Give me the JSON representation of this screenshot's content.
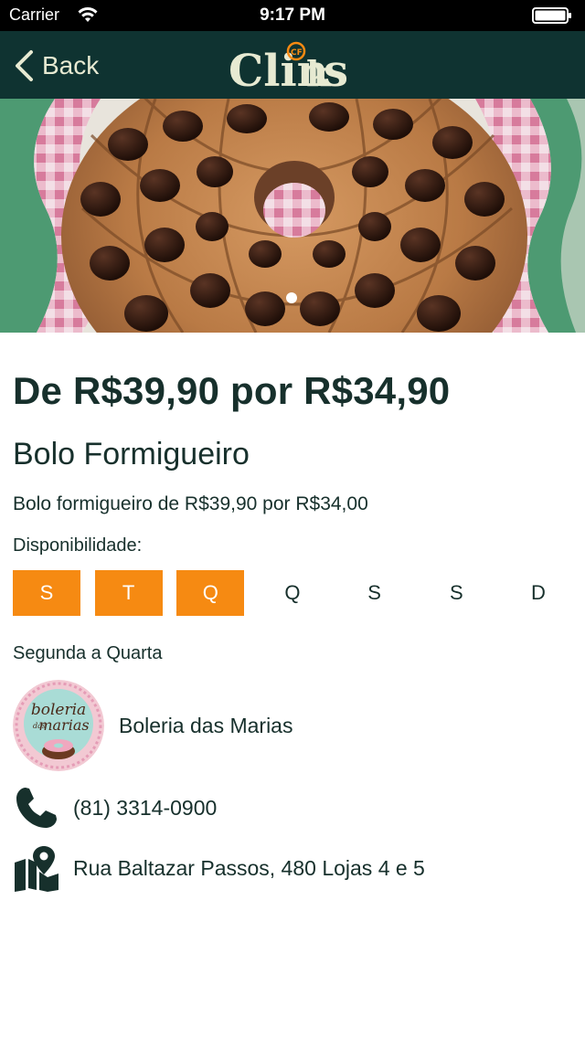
{
  "status_bar": {
    "carrier": "Carrier",
    "time": "9:17 PM"
  },
  "nav": {
    "back_label": "Back",
    "logo_text": "Clinks",
    "logo_badge": "CF"
  },
  "product": {
    "price": "De R$39,90 por R$34,90",
    "title": "Bolo Formigueiro",
    "description": "Bolo formigueiro de R$39,90 por R$34,00",
    "availability_label": "Disponibilidade:",
    "days": [
      {
        "label": "S",
        "active": true
      },
      {
        "label": "T",
        "active": true
      },
      {
        "label": "Q",
        "active": true
      },
      {
        "label": "Q",
        "active": false
      },
      {
        "label": "S",
        "active": false
      },
      {
        "label": "S",
        "active": false
      },
      {
        "label": "D",
        "active": false
      }
    ],
    "days_summary": "Segunda a Quarta"
  },
  "store": {
    "name": "Boleria das Marias",
    "logo_text_top": "boleria",
    "logo_text_mid": "das",
    "logo_text_bottom": "marias"
  },
  "contact": {
    "phone": "(81) 3314-0900",
    "address": "Rua Baltazar Passos, 480 Lojas 4 e 5"
  },
  "colors": {
    "nav_background": "#0f3331",
    "accent_orange": "#f68a12",
    "text_dark": "#17302c",
    "logo_cream": "#e7ead2"
  },
  "carousel": {
    "page_count": 1,
    "current_page": 1
  }
}
